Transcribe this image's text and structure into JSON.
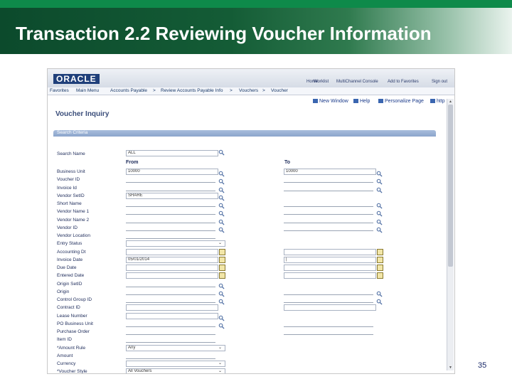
{
  "slide": {
    "title": "Transaction 2.2 Reviewing Voucher Information",
    "page_number": "35"
  },
  "app": {
    "logo": "ORACLE",
    "top_links": [
      "Home",
      "Worklist",
      "MultiChannel Console",
      "Add to Favorites",
      "Sign out"
    ],
    "nav": [
      "Favorites",
      "Main Menu",
      "Accounts Payable",
      ">",
      "Review Accounts Payable Info",
      ">",
      "Vouchers",
      ">",
      "Voucher"
    ],
    "toolbar": [
      "New Window",
      "Help",
      "Personalize Page",
      "http"
    ],
    "page_title": "Voucher Inquiry",
    "section": "Search Criteria"
  },
  "form": {
    "search_name_label": "Search Name",
    "search_name_value": "ALL",
    "from_header": "From",
    "to_header": "To",
    "fields": [
      {
        "label": "Business Unit",
        "from": "10000",
        "to": "10000"
      },
      {
        "label": "Voucher ID",
        "from": "",
        "to": ""
      },
      {
        "label": "Invoice Id",
        "from": "",
        "to": ""
      },
      {
        "label": "Vendor SetID",
        "from": "SHARE",
        "to": ""
      },
      {
        "label": "Short Name",
        "from": "",
        "to": ""
      },
      {
        "label": "Vendor Name 1",
        "from": "",
        "to": ""
      },
      {
        "label": "Vendor Name 2",
        "from": "",
        "to": ""
      },
      {
        "label": "Vendor ID",
        "from": "",
        "to": ""
      },
      {
        "label": "Vendor Location",
        "from": "",
        "to": ""
      },
      {
        "label": "Entry Status",
        "from": "",
        "to": ""
      },
      {
        "label": "Accounting Dt",
        "from": "",
        "to": ""
      },
      {
        "label": "Invoice Date",
        "from": "05/01/2014",
        "to": "|"
      },
      {
        "label": "Due Date",
        "from": "",
        "to": ""
      },
      {
        "label": "Entered Date",
        "from": "",
        "to": ""
      },
      {
        "label": "Origin SetID",
        "from": "",
        "to": ""
      },
      {
        "label": "Origin",
        "from": "",
        "to": ""
      },
      {
        "label": "Control Group ID",
        "from": "",
        "to": ""
      },
      {
        "label": "Contract ID",
        "from": "",
        "to": ""
      },
      {
        "label": "Lease Number",
        "from": "",
        "to": ""
      },
      {
        "label": "PO Business Unit",
        "from": "",
        "to": ""
      },
      {
        "label": "Purchase Order",
        "from": "",
        "to": ""
      },
      {
        "label": "Item ID",
        "from": "",
        "to": ""
      },
      {
        "label": "*Amount Rule",
        "from": "Any",
        "to": ""
      },
      {
        "label": "Amount",
        "from": "",
        "to": ""
      },
      {
        "label": "Currency",
        "from": "",
        "to": ""
      },
      {
        "label": "*Voucher Style",
        "from": "All Vouchers",
        "to": ""
      }
    ]
  }
}
